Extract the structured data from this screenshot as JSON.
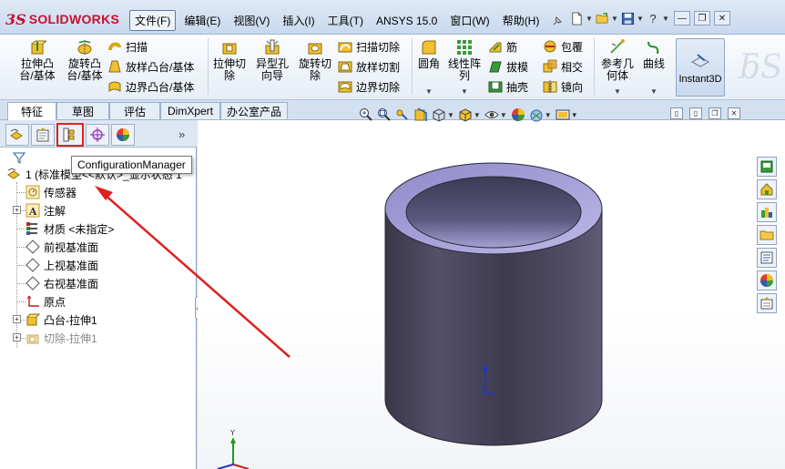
{
  "app": {
    "logo_prefix": "3S",
    "logo_text": "SOLIDWORKS"
  },
  "menu": [
    {
      "label": "文件(F)",
      "active": true
    },
    {
      "label": "编辑(E)"
    },
    {
      "label": "视图(V)"
    },
    {
      "label": "插入(I)"
    },
    {
      "label": "工具(T)"
    },
    {
      "label": "ANSYS 15.0"
    },
    {
      "label": "窗口(W)"
    },
    {
      "label": "帮助(H)"
    }
  ],
  "title_tools": {
    "new": "new-document-icon",
    "open": "open-folder-icon",
    "save": "save-icon",
    "help": "?",
    "window_buttons": [
      "—",
      "❐",
      "✕"
    ]
  },
  "commands": {
    "extrude_boss": "拉伸凸台/基体",
    "revolve_boss": "旋转凸台/基体",
    "sweep": "扫描",
    "loft": "放样凸台/基体",
    "boundary_boss": "边界凸台/基体",
    "extrude_cut": "拉伸切除",
    "hole_wizard": "异型孔向导",
    "revolve_cut": "旋转切除",
    "swept_cut": "扫描切除",
    "lofted_cut": "放样切割",
    "boundary_cut": "边界切除",
    "fillet": "圆角",
    "linear_pattern": "线性阵列",
    "rib": "筋",
    "draft": "拔模",
    "shell": "抽壳",
    "wrap": "包覆",
    "intersect": "相交",
    "mirror": "镜向",
    "ref_geometry": "参考几何体",
    "curves": "曲线",
    "instant3d": "Instant3D"
  },
  "cm_tabs": [
    "特征",
    "草图",
    "评估",
    "DimXpert",
    "办公室产品"
  ],
  "panel": {
    "more": "»",
    "tooltip": "ConfigurationManager",
    "tree": [
      {
        "label": "1  (标准模型<<默认>_显示状态 1"
      },
      {
        "label": "传感器"
      },
      {
        "label": "注解"
      },
      {
        "label": "材质 <未指定>"
      },
      {
        "label": "前视基准面"
      },
      {
        "label": "上视基准面"
      },
      {
        "label": "右视基准面"
      },
      {
        "label": "原点"
      },
      {
        "label": "凸台-拉伸1"
      },
      {
        "label": "切除-拉伸1"
      }
    ]
  },
  "colors": {
    "accent_red": "#e02020",
    "cylinder": "#4a4658",
    "cylinder_inner": "#a9a4d6"
  }
}
